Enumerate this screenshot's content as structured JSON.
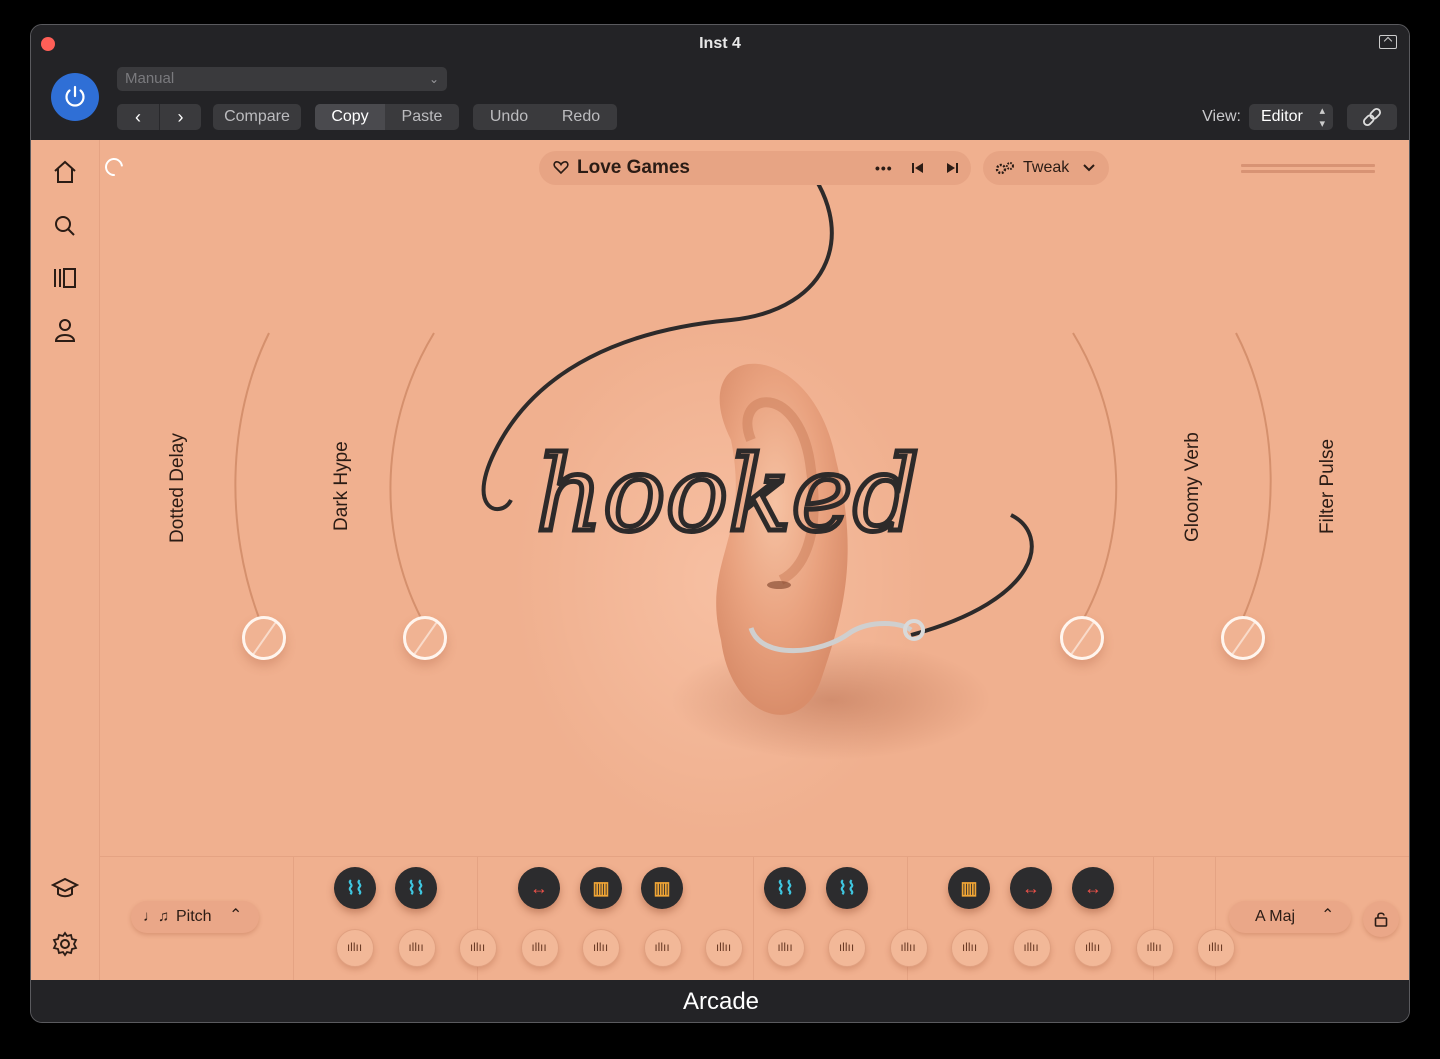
{
  "window": {
    "title": "Inst 4",
    "footer_title": "Arcade"
  },
  "toolbar": {
    "preset_menu_value": "Manual",
    "compare_label": "Compare",
    "copy_label": "Copy",
    "paste_label": "Paste",
    "undo_label": "Undo",
    "redo_label": "Redo",
    "view_label": "View:",
    "view_value": "Editor"
  },
  "sidebar": {
    "icons": [
      "home-icon",
      "search-icon",
      "library-icon",
      "user-icon",
      "learn-icon",
      "gear-icon"
    ]
  },
  "plugin": {
    "preset_name": "Love Games",
    "more_label": "•••",
    "tweak_label": "Tweak",
    "artwork_text": "hooked",
    "macros": [
      {
        "label": "Dotted Delay"
      },
      {
        "label": "Dark Hype"
      },
      {
        "label": "Gloomy Verb"
      },
      {
        "label": "Filter Pulse"
      }
    ]
  },
  "bottom": {
    "pitch_label": "Pitch",
    "key_label": "A Maj",
    "top_pads": [
      {
        "icon": "dna-icon",
        "color": "#3fc7e0"
      },
      {
        "icon": "dna-icon",
        "color": "#3fc7e0"
      },
      {
        "icon": "stretch-arrows-icon",
        "color": "#f0524a"
      },
      {
        "icon": "bars-icon",
        "color": "#f0a535"
      },
      {
        "icon": "bars-icon",
        "color": "#f0a535"
      },
      {
        "icon": "dna-icon",
        "color": "#3fc7e0"
      },
      {
        "icon": "dna-icon",
        "color": "#3fc7e0"
      },
      {
        "icon": "bars-icon",
        "color": "#f0a535"
      },
      {
        "icon": "stretch-arrows-icon",
        "color": "#f0524a"
      },
      {
        "icon": "stretch-arrows-icon",
        "color": "#f0524a"
      }
    ],
    "bottom_pad_count": 15
  },
  "colors": {
    "background": "#f0b08f",
    "chrome": "#232326",
    "power": "#2f6fd6",
    "close": "#ff5f57"
  }
}
